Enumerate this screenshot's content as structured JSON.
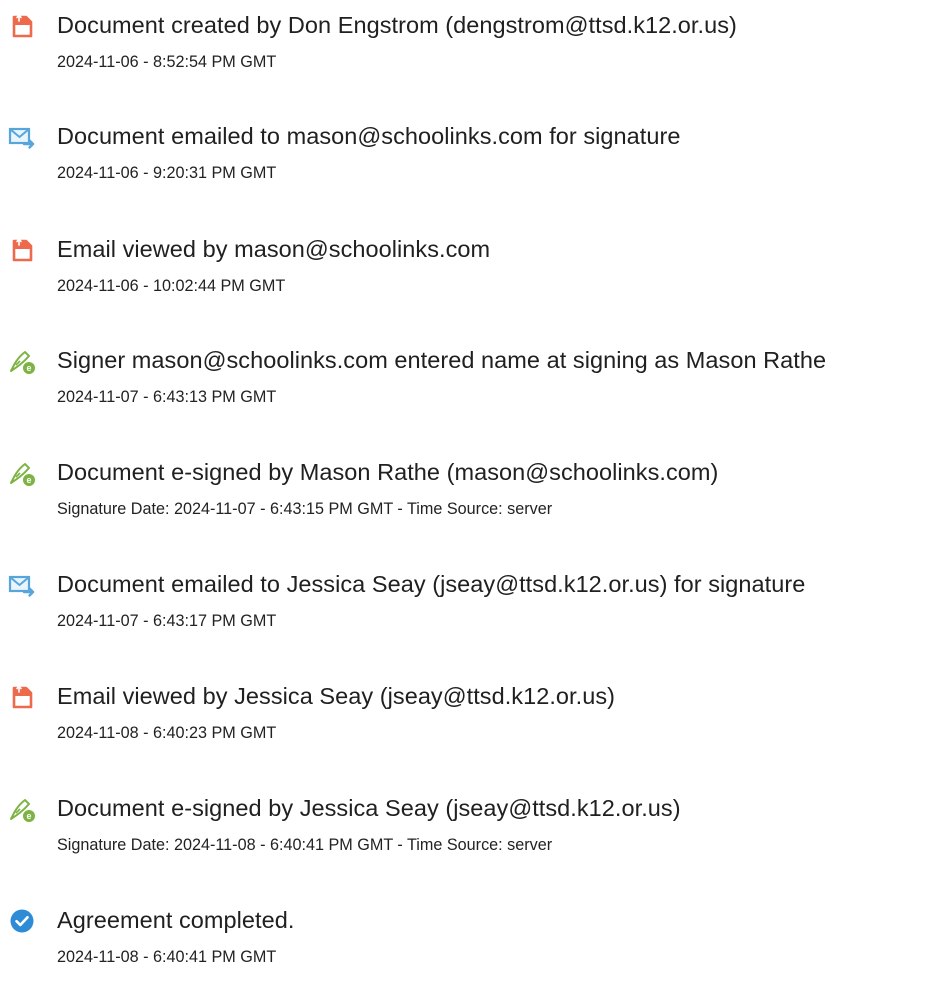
{
  "colors": {
    "doc_icon": "#ee6a4c",
    "mail_icon": "#56a6dc",
    "sign_icon": "#7cb342",
    "complete_icon": "#2e8bd6",
    "text": "#202020"
  },
  "events": [
    {
      "icon": "document-icon",
      "title": "Document created by Don Engstrom (dengstrom@ttsd.k12.or.us)",
      "detail": "2024-11-06 - 8:52:54 PM GMT"
    },
    {
      "icon": "email-sent-icon",
      "title": "Document emailed to mason@schoolinks.com for signature",
      "detail": "2024-11-06 - 9:20:31 PM GMT"
    },
    {
      "icon": "document-icon",
      "title": "Email viewed by mason@schoolinks.com",
      "detail": "2024-11-06 - 10:02:44 PM GMT"
    },
    {
      "icon": "e-sign-pen-icon",
      "title": "Signer mason@schoolinks.com entered name at signing as Mason Rathe",
      "detail": "2024-11-07 - 6:43:13 PM GMT"
    },
    {
      "icon": "e-sign-pen-icon",
      "title": "Document e-signed by Mason Rathe (mason@schoolinks.com)",
      "detail": "Signature Date: 2024-11-07 - 6:43:15 PM GMT - Time Source: server"
    },
    {
      "icon": "email-sent-icon",
      "title": "Document emailed to Jessica Seay (jseay@ttsd.k12.or.us) for signature",
      "detail": "2024-11-07 - 6:43:17 PM GMT"
    },
    {
      "icon": "document-icon",
      "title": "Email viewed by Jessica Seay (jseay@ttsd.k12.or.us)",
      "detail": "2024-11-08 - 6:40:23 PM GMT"
    },
    {
      "icon": "e-sign-pen-icon",
      "title": "Document e-signed by Jessica Seay (jseay@ttsd.k12.or.us)",
      "detail": "Signature Date: 2024-11-08 - 6:40:41 PM GMT - Time Source: server"
    },
    {
      "icon": "checkmark-circle-icon",
      "title": "Agreement completed.",
      "detail": "2024-11-08 - 6:40:41 PM GMT"
    }
  ]
}
